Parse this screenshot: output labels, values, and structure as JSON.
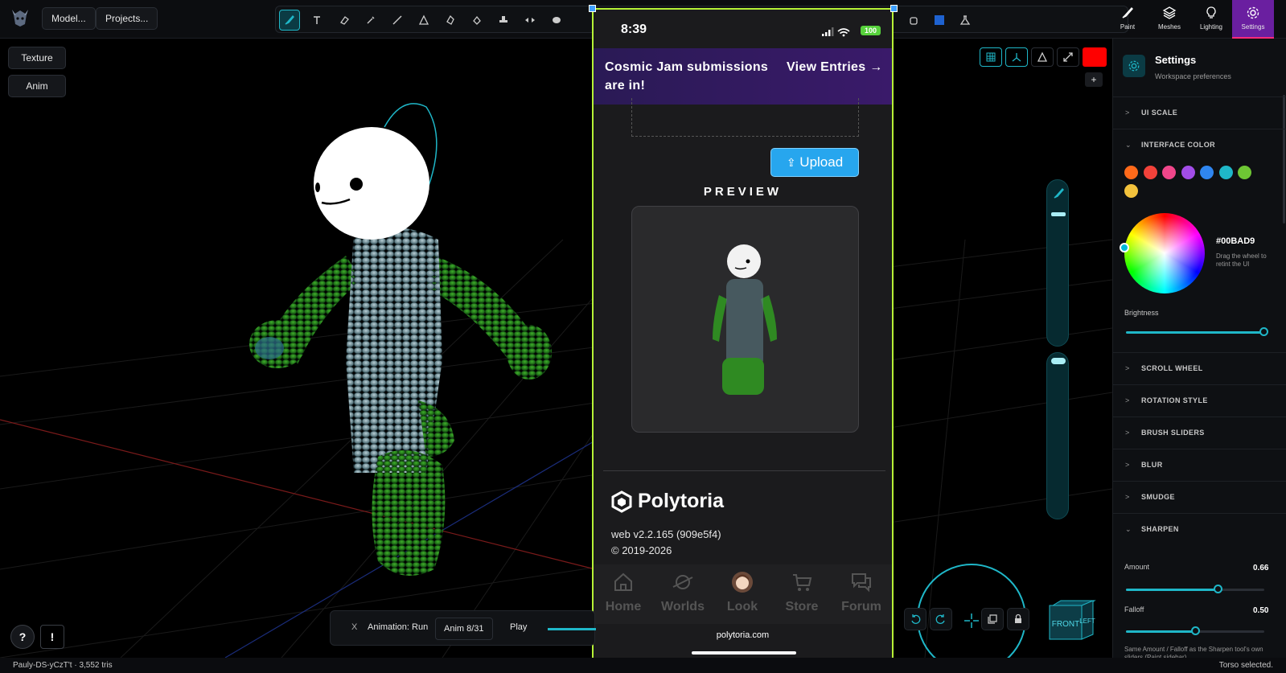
{
  "toolbar": {
    "model_btn": "Model...",
    "projects_btn": "Projects..."
  },
  "right_tabs": [
    {
      "label": "Paint",
      "icon": "brush-icon"
    },
    {
      "label": "Meshes",
      "icon": "layers-icon"
    },
    {
      "label": "Lighting",
      "icon": "bulb-icon"
    },
    {
      "label": "Settings",
      "icon": "gear-icon",
      "active": true
    }
  ],
  "side_buttons": {
    "texture": "Texture",
    "anim": "Anim"
  },
  "phone": {
    "time": "8:39",
    "battery": "100",
    "banner_text": "Cosmic Jam submissions are in!",
    "banner_link": "View Entries →",
    "upload_label": "Upload",
    "preview_title": "PREVIEW",
    "brand": "Polytoria",
    "version": "web v2.2.165 (909e5f4)",
    "copyright": "© 2019-2026",
    "nav": [
      {
        "label": "Home",
        "icon": "home-icon"
      },
      {
        "label": "Worlds",
        "icon": "planet-icon"
      },
      {
        "label": "Look",
        "icon": "avatar-icon"
      },
      {
        "label": "Store",
        "icon": "cart-icon"
      },
      {
        "label": "Forum",
        "icon": "chat-icon"
      }
    ],
    "url": "polytoria.com"
  },
  "anim_bar": {
    "close": "X",
    "animation": "Animation: Run",
    "count": "Anim 8/31",
    "play": "Play"
  },
  "help": {
    "question": "?",
    "alert": "!"
  },
  "status": {
    "left": "Pauly-DS-yCzT't  ·  3,552 tris",
    "right": "Torso selected."
  },
  "viewcube": {
    "front": "FRONT",
    "left": "LEFT"
  },
  "colors": {
    "accent": "#00BAD9",
    "tab_active": "#6a1fa0",
    "swatch_red": "#ff0000"
  },
  "settings": {
    "title": "Settings",
    "subtitle": "Workspace preferences",
    "sections": {
      "ui_scale": "UI SCALE",
      "interface_color": "INTERFACE COLOR",
      "scroll_wheel": "SCROLL WHEEL",
      "rotation_style": "ROTATION STYLE",
      "brush_sliders": "BRUSH SLIDERS",
      "blur": "BLUR",
      "smudge": "SMUDGE",
      "sharpen": "SHARPEN"
    },
    "swatches": [
      "#ff6a1a",
      "#f2423a",
      "#f0468a",
      "#a24de8",
      "#2f86f0",
      "#1fb7c8",
      "#6ec634",
      "#f2c23c"
    ],
    "hex": "#00BAD9",
    "hex_hint": "Drag the wheel to retint the UI",
    "brightness_label": "Brightness",
    "brightness_value": 1.0,
    "amount_label": "Amount",
    "amount_value": "0.66",
    "falloff_label": "Falloff",
    "falloff_value": "0.50",
    "note": "Same Amount / Falloff as the Sharpen tool's own sliders (Paint sidebar)."
  }
}
